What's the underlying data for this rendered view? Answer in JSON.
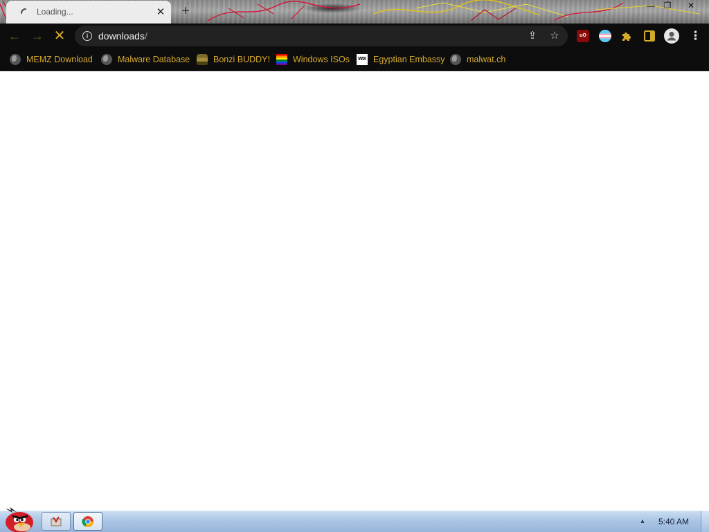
{
  "colors": {
    "accent": "#d3ab2b",
    "chrome_dark": "#0d0d0d",
    "omnibox_bg": "#222222",
    "bookmark_text": "#d8ab2e"
  },
  "tab": {
    "title": "Loading...",
    "spinner_icon": "loading-spinner-icon",
    "close_glyph": "✕"
  },
  "new_tab_glyph": "+",
  "window_controls": {
    "minimize": "—",
    "maximize": "❐",
    "close": "✕"
  },
  "toolbar": {
    "back_glyph": "←",
    "forward_glyph": "→",
    "reload_glyph": "✕"
  },
  "omnibox": {
    "info_glyph": "i",
    "url_host": "downloads",
    "url_rest": "/",
    "share_glyph": "⇪",
    "star_glyph": "☆"
  },
  "extensions": [
    {
      "name": "ublock-origin-icon",
      "label": "uO",
      "color": "#8b0b0b"
    },
    {
      "name": "flag-extension-icon",
      "label": "",
      "color": "#e9e9f2"
    },
    {
      "name": "puzzle-icon",
      "label": "",
      "color": "#d3ab2b"
    },
    {
      "name": "side-panel-icon",
      "label": "",
      "color": "#d3ab2b"
    },
    {
      "name": "profile-avatar-icon",
      "label": "",
      "color": "#e7e7e7"
    },
    {
      "name": "kebab-menu-icon",
      "label": "⋮",
      "color": "#e7e7e7"
    }
  ],
  "bookmarks": [
    {
      "label": "MEMZ Download",
      "icon": "globe-icon"
    },
    {
      "label": "Malware Database",
      "icon": "globe-icon"
    },
    {
      "label": "Bonzi BUDDY!",
      "icon": "bonzi-icon"
    },
    {
      "label": "Windows ISOs",
      "icon": "rainbow-flag-icon"
    },
    {
      "label": "Egyptian Embassy",
      "icon": "wix-icon",
      "icon_text": "WIX"
    },
    {
      "label": "malwat.ch",
      "icon": "globe-icon"
    }
  ],
  "taskbar": {
    "start_icon": "angry-bird-start-icon",
    "tray_arrow": "▲",
    "clock": "5:40 AM"
  }
}
